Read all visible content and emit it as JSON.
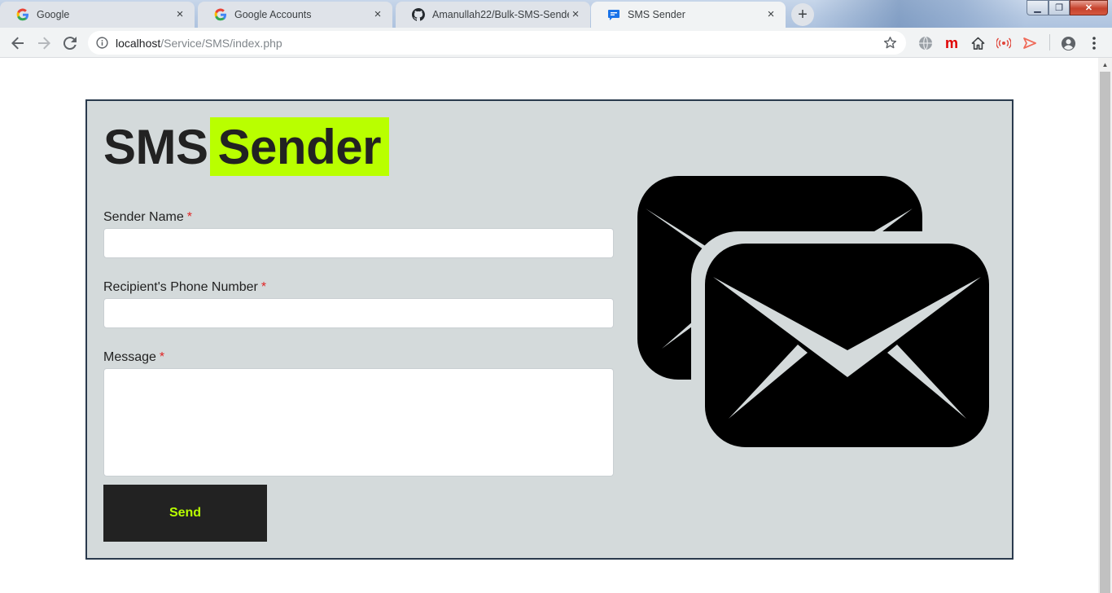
{
  "browser": {
    "tabs": [
      {
        "title": "Google",
        "icon": "google-icon",
        "active": false
      },
      {
        "title": "Google Accounts",
        "icon": "google-icon",
        "active": false
      },
      {
        "title": "Amanullah22/Bulk-SMS-Sender",
        "icon": "github-icon",
        "active": false
      },
      {
        "title": "SMS Sender",
        "icon": "chat-icon",
        "active": true
      }
    ],
    "close_glyph": "×",
    "new_tab_glyph": "+",
    "window_controls": {
      "minimize": "▁",
      "maximize": "❐",
      "close": "✕"
    },
    "url": {
      "host": "localhost",
      "path": "/Service/SMS/index.php"
    }
  },
  "page": {
    "title_part1": "SMS",
    "title_part2": "Sender",
    "accent_color": "#b9ff00",
    "form": {
      "sender_label": "Sender Name",
      "sender_value": "",
      "phone_label": "Recipient's Phone Number",
      "phone_value": "",
      "message_label": "Message",
      "message_value": "",
      "required_mark": "*",
      "send_label": "Send"
    },
    "illustration_icon": "envelopes-icon"
  }
}
